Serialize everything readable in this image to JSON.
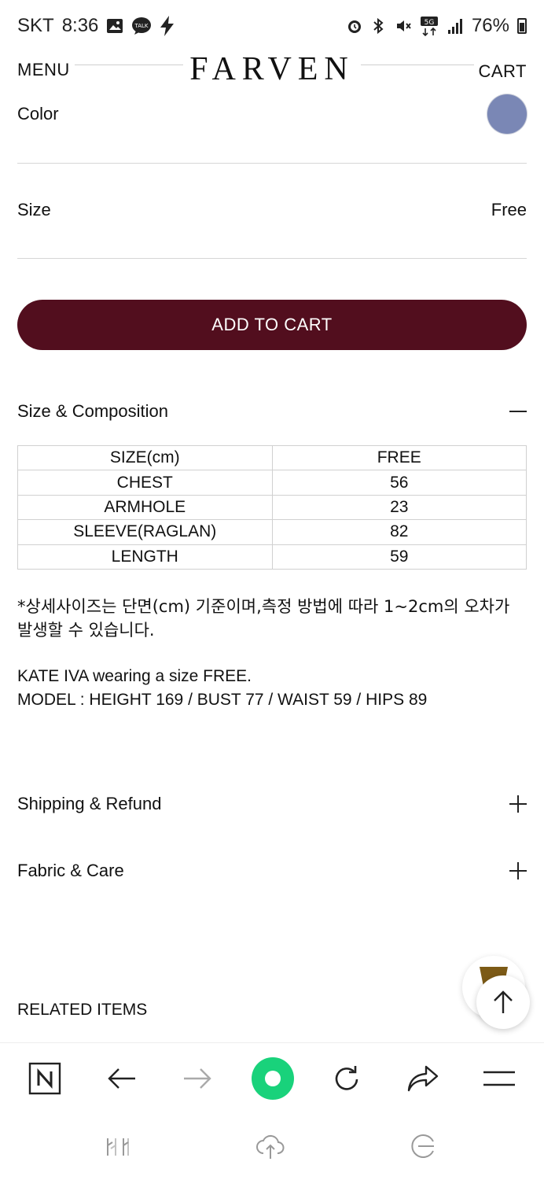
{
  "status_bar": {
    "carrier": "SKT",
    "time": "8:36",
    "left_icons": [
      "gallery-icon",
      "kakaotalk-icon",
      "bolt-icon"
    ],
    "right_icons": [
      "alarm-icon",
      "bluetooth-icon",
      "mute-icon",
      "5g-icon",
      "signal-icon"
    ],
    "battery": "76%"
  },
  "header": {
    "menu_label": "MENU",
    "logo": "FARVEN",
    "cart_label": "CART"
  },
  "options": {
    "color_label": "Color",
    "color_swatch": "#7a87b5",
    "size_label": "Size",
    "size_value": "Free"
  },
  "add_to_cart": {
    "label": "ADD TO CART",
    "color": "#520e1e"
  },
  "size_composition": {
    "title": "Size & Composition",
    "toggle": "minus-icon",
    "table": [
      [
        "SIZE(cm)",
        "FREE"
      ],
      [
        "CHEST",
        "56"
      ],
      [
        "ARMHOLE",
        "23"
      ],
      [
        "SLEEVE(RAGLAN)",
        "82"
      ],
      [
        "LENGTH",
        "59"
      ]
    ],
    "note": "*상세사이즈는 단면(cm) 기준이며,측정 방법에 따라 1~2cm의 오차가 발생할 수 있습니다.",
    "model_line1": "KATE IVA wearing a size FREE.",
    "model_line2": "MODEL : HEIGHT 169 / BUST 77 / WAIST 59 / HIPS 89"
  },
  "shipping": {
    "title": "Shipping & Refund",
    "toggle": "plus-icon"
  },
  "fabric": {
    "title": "Fabric & Care",
    "toggle": "plus-icon"
  },
  "related": {
    "title": "RELATED ITEMS"
  },
  "browser_toolbar": [
    "naver-icon",
    "back-icon",
    "forward-icon",
    "green-dot-icon",
    "refresh-icon",
    "share-icon",
    "menu-icon"
  ],
  "system_nav": [
    "recent-apps-icon",
    "cloud-icon",
    "gesture-icon"
  ]
}
